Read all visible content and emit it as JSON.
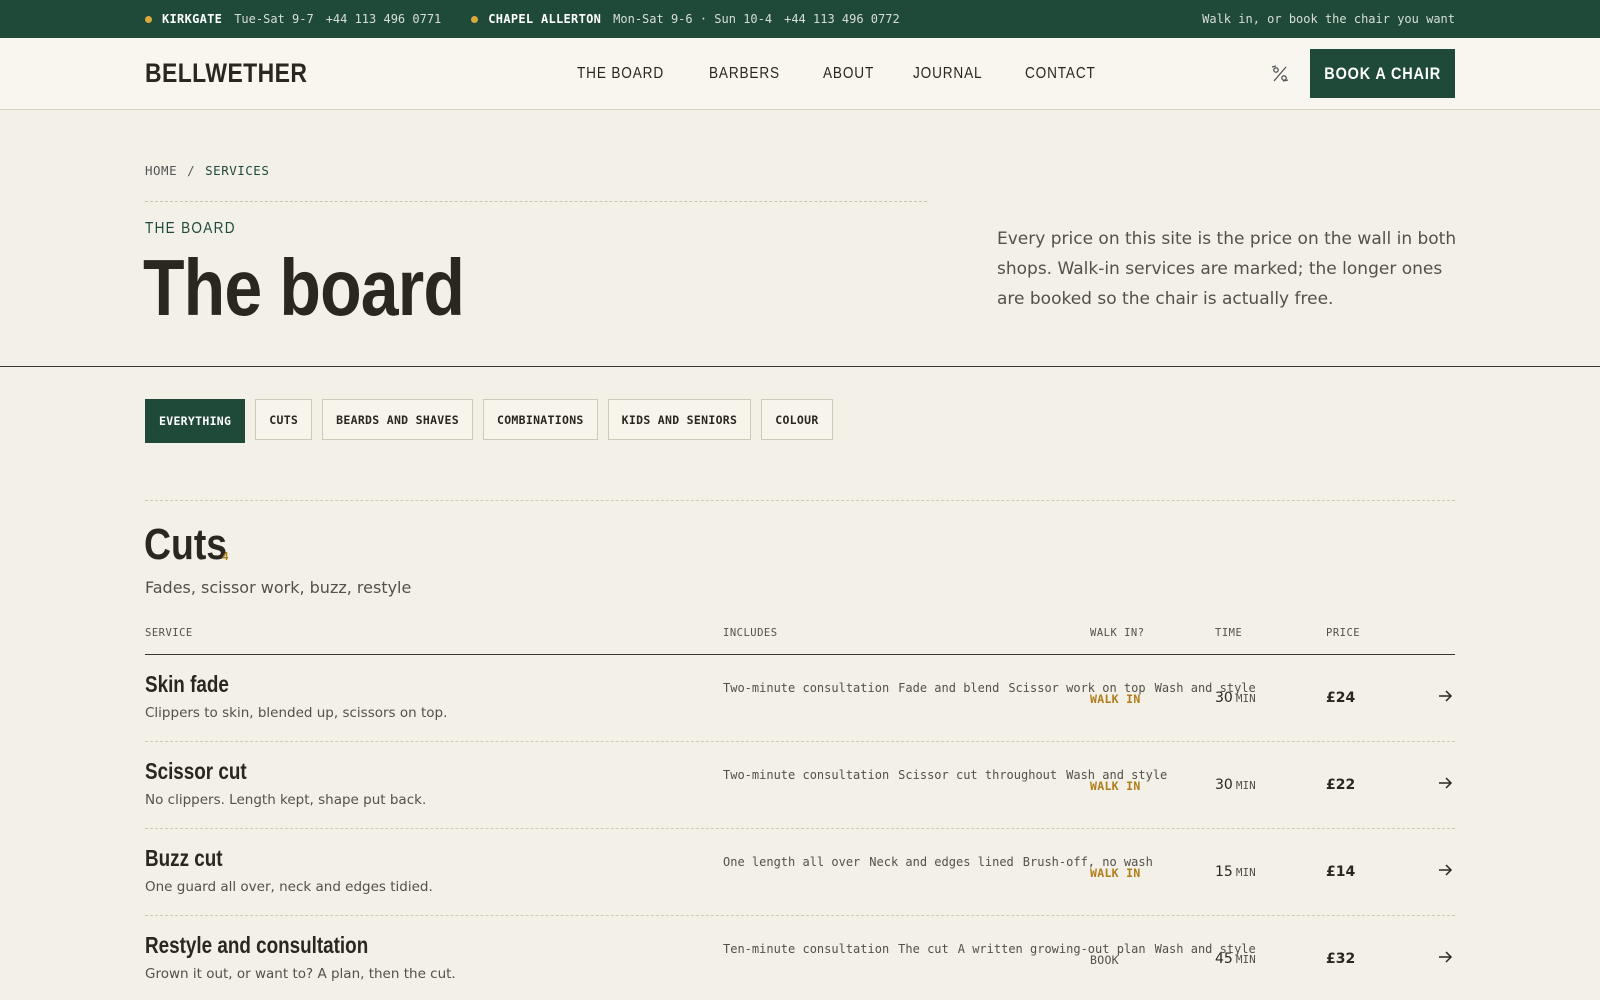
{
  "topbar": {
    "loc1": {
      "name": "KIRKGATE",
      "hours": "Tue-Sat 9-7",
      "phone": "+44 113 496 0771"
    },
    "loc2": {
      "name": "CHAPEL ALLERTON",
      "hours": "Mon-Sat 9-6 · Sun 10-4",
      "phone": "+44 113 496 0772"
    },
    "tagline": "Walk in, or book the chair you want",
    "dot_color": "#d9a93c"
  },
  "header": {
    "logo": "BELLWETHER",
    "nav": [
      "THE BOARD",
      "BARBERS",
      "ABOUT",
      "JOURNAL",
      "CONTACT"
    ],
    "icon": "percent-icon",
    "cta": "BOOK A CHAIR"
  },
  "hero": {
    "breadcrumb": {
      "home": "HOME",
      "sep": "/",
      "current": "SERVICES"
    },
    "eyebrow": "THE BOARD",
    "title": "The board",
    "text": "Every price on this site is the price on the wall in both shops. Walk-in services are marked; the longer ones are booked so the chair is actually free."
  },
  "filters": [
    "EVERYTHING",
    "CUTS",
    "BEARDS AND SHAVES",
    "COMBINATIONS",
    "KIDS AND SENIORS",
    "COLOUR"
  ],
  "section": {
    "title": "Cuts",
    "count": "4",
    "subtitle": "Fades, scissor work, buzz, restyle",
    "columns": {
      "service": "SERVICE",
      "includes": "INCLUDES",
      "walk": "WALK IN?",
      "time": "TIME",
      "price": "PRICE"
    },
    "rows": [
      {
        "name": "Skin fade",
        "desc": "Clippers to skin, blended up, scissors on top.",
        "includes": [
          "Two-minute consultation",
          "Fade and blend",
          "Scissor work on top",
          "Wash and style"
        ],
        "walk": "WALK IN",
        "time": "30",
        "unit": "MIN",
        "price": "£24"
      },
      {
        "name": "Scissor cut",
        "desc": "No clippers. Length kept, shape put back.",
        "includes": [
          "Two-minute consultation",
          "Scissor cut throughout",
          "Wash and style"
        ],
        "walk": "WALK IN",
        "time": "30",
        "unit": "MIN",
        "price": "£22"
      },
      {
        "name": "Buzz cut",
        "desc": "One guard all over, neck and edges tidied.",
        "includes": [
          "One length all over",
          "Neck and edges lined",
          "Brush-off, no wash"
        ],
        "walk": "WALK IN",
        "time": "15",
        "unit": "MIN",
        "price": "£14"
      },
      {
        "name": "Restyle and consultation",
        "desc": "Grown it out, or want to? A plan, then the cut.",
        "includes": [
          "Ten-minute consultation",
          "The cut",
          "A written growing-out plan",
          "Wash and style"
        ],
        "walk": "BOOK",
        "time": "45",
        "unit": "MIN",
        "price": "£32"
      }
    ]
  },
  "colors": {
    "primary": "#1f4a3a",
    "accent": "#b07d1a",
    "background": "#f3f0e8"
  }
}
